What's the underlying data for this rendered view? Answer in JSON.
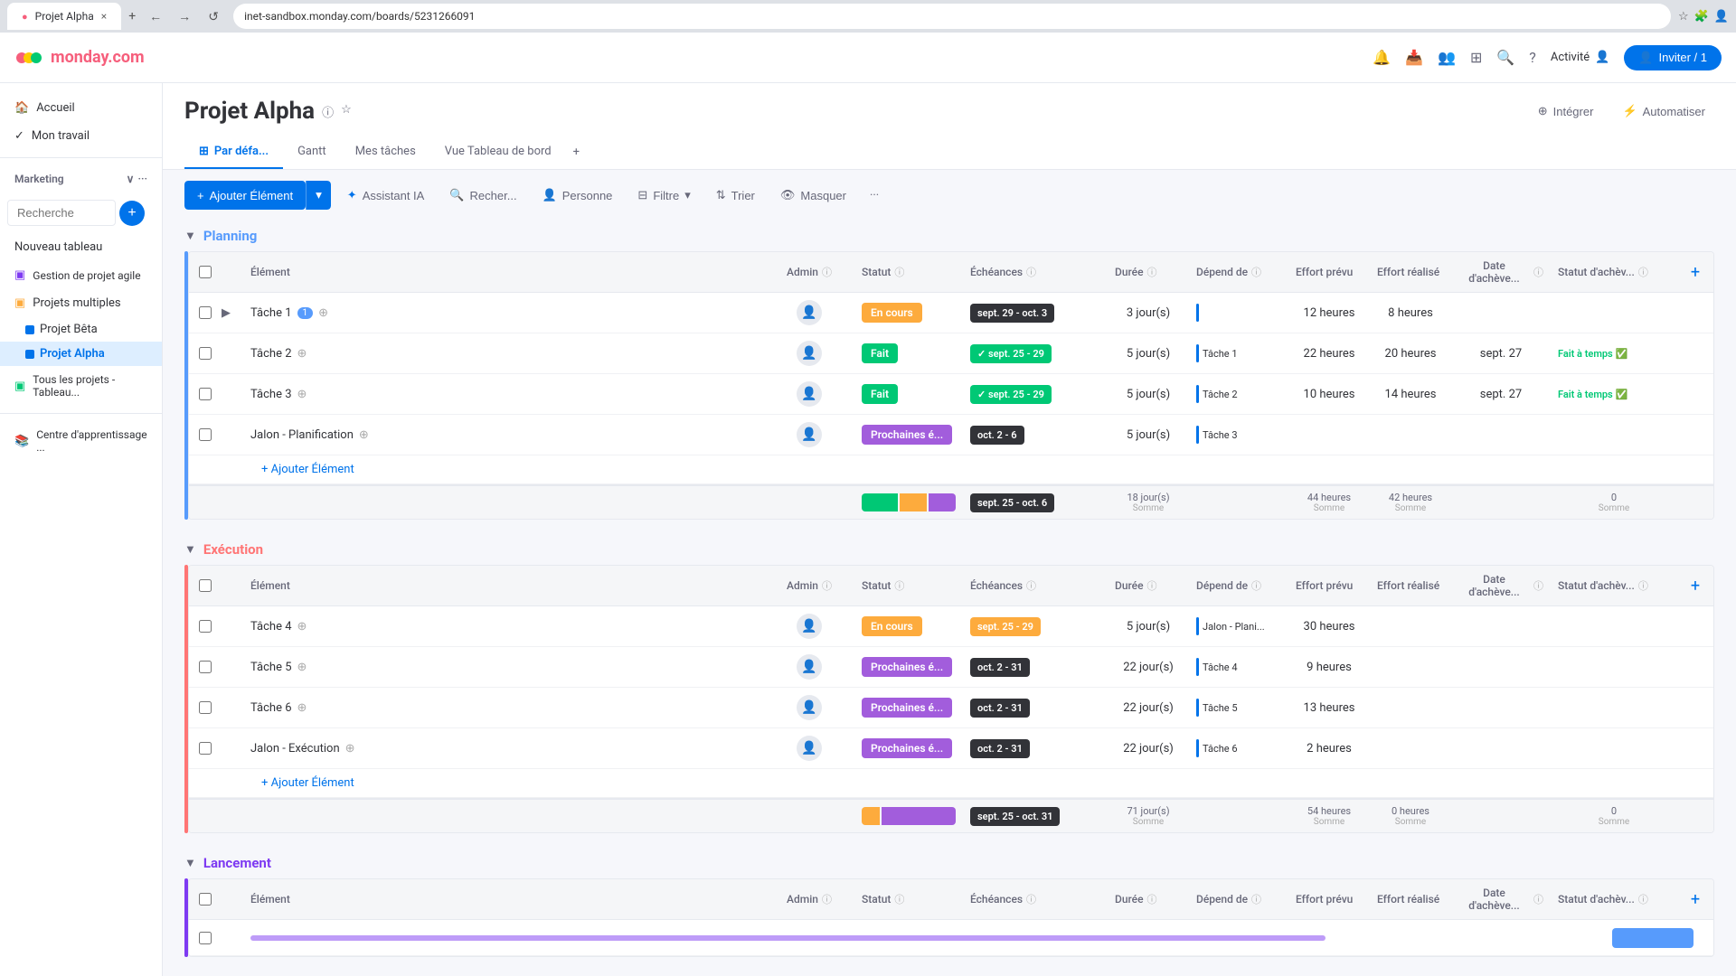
{
  "browser": {
    "tab_title": "Projet Alpha",
    "url": "inet-sandbox.monday.com/boards/5231266091",
    "close_icon": "×",
    "back_icon": "←",
    "forward_icon": "→",
    "refresh_icon": "↺"
  },
  "nav": {
    "logo_text": "monday.com",
    "activity_label": "Activité",
    "inviter_label": "Inviter / 1"
  },
  "sidebar": {
    "accueil": "Accueil",
    "mon_travail": "Mon travail",
    "marketing_label": "Marketing",
    "search_placeholder": "Recherche",
    "nouveau_tableau": "Nouveau tableau",
    "gestion_projet": "Gestion de projet agile",
    "projets_multiples": "Projets multiples",
    "projet_beta": "Projet Bêta",
    "projet_alpha": "Projet Alpha",
    "tous_projets": "Tous les projets - Tableau...",
    "centre_apprentissage": "Centre d'apprentissage ..."
  },
  "page": {
    "title": "Projet Alpha",
    "integrer_label": "Intégrer",
    "automatiser_label": "Automatiser",
    "tabs": [
      {
        "label": "Par défa...",
        "active": true,
        "icon": "⊞"
      },
      {
        "label": "Gantt",
        "active": false
      },
      {
        "label": "Mes tâches",
        "active": false
      },
      {
        "label": "Vue Tableau de bord",
        "active": false
      }
    ]
  },
  "toolbar": {
    "ajouter_element": "Ajouter Élément",
    "assistant_ia": "Assistant IA",
    "rechercher": "Recher...",
    "personne": "Personne",
    "filtre": "Filtre",
    "trier": "Trier",
    "masquer": "Masquer"
  },
  "columns": {
    "element": "Élément",
    "admin": "Admin",
    "statut": "Statut",
    "echeances": "Échéances",
    "duree": "Durée",
    "depend_de": "Dépend de",
    "effort_prevu": "Effort prévu",
    "effort_realise": "Effort réalisé",
    "date_achevement": "Date d'achève...",
    "statut_achevement": "Statut d'achèv..."
  },
  "planning": {
    "title": "Planning",
    "rows": [
      {
        "name": "Tâche 1",
        "badge": "1",
        "statut": "En cours",
        "statut_class": "status-encours",
        "echeance": "sept. 29 - oct. 3",
        "echeance_class": "date-badge",
        "duree": "3 jour(s)",
        "depend": "",
        "effort_prev": "12 heures",
        "effort_real": "8 heures",
        "date_ach": "",
        "statut_ach": "",
        "statut_ach_class": ""
      },
      {
        "name": "Tâche 2",
        "badge": "",
        "statut": "Fait",
        "statut_class": "status-fait",
        "echeance": "✓ sept. 25 - 29",
        "echeance_class": "date-badge green",
        "duree": "5 jour(s)",
        "depend": "Tâche 1",
        "effort_prev": "22 heures",
        "effort_real": "20 heures",
        "date_ach": "sept. 27",
        "statut_ach": "Fait à temps",
        "statut_ach_class": "fait-at"
      },
      {
        "name": "Tâche 3",
        "badge": "",
        "statut": "Fait",
        "statut_class": "status-fait",
        "echeance": "✓ sept. 25 - 29",
        "echeance_class": "date-badge green",
        "duree": "5 jour(s)",
        "depend": "Tâche 2",
        "effort_prev": "10 heures",
        "effort_real": "14 heures",
        "date_ach": "sept. 27",
        "statut_ach": "Fait à temps",
        "statut_ach_class": "fait-at"
      },
      {
        "name": "Jalon - Planification",
        "badge": "",
        "statut": "Prochaines é...",
        "statut_class": "status-prochaines",
        "echeance": "oct. 2 - 6",
        "echeance_class": "date-badge",
        "duree": "5 jour(s)",
        "depend": "Tâche 3",
        "effort_prev": "",
        "effort_real": "",
        "date_ach": "",
        "statut_ach": "",
        "statut_ach_class": ""
      }
    ],
    "summary": {
      "echeance": "sept. 25 - oct. 6",
      "duree": "18 jour(s)",
      "duree_label": "Somme",
      "effort_prev": "44 heures",
      "effort_prev_label": "Somme",
      "effort_real": "42 heures",
      "effort_real_label": "Somme",
      "statut_ach": "0",
      "statut_ach_label": "Somme"
    }
  },
  "execution": {
    "title": "Exécution",
    "rows": [
      {
        "name": "Tâche 4",
        "statut": "En cours",
        "statut_class": "status-encours",
        "echeance": "sept. 25 - 29",
        "echeance_class": "date-badge orange",
        "duree": "5 jour(s)",
        "depend": "Jalon - Plani...",
        "effort_prev": "30 heures",
        "effort_real": "",
        "date_ach": "",
        "statut_ach": "",
        "statut_ach_class": ""
      },
      {
        "name": "Tâche 5",
        "statut": "Prochaines é...",
        "statut_class": "status-prochaines",
        "echeance": "oct. 2 - 31",
        "echeance_class": "date-badge",
        "duree": "22 jour(s)",
        "depend": "Tâche 4",
        "effort_prev": "9 heures",
        "effort_real": "",
        "date_ach": "",
        "statut_ach": "",
        "statut_ach_class": ""
      },
      {
        "name": "Tâche 6",
        "statut": "Prochaines é...",
        "statut_class": "status-prochaines",
        "echeance": "oct. 2 - 31",
        "echeance_class": "date-badge",
        "duree": "22 jour(s)",
        "depend": "Tâche 5",
        "effort_prev": "13 heures",
        "effort_real": "",
        "date_ach": "",
        "statut_ach": "",
        "statut_ach_class": ""
      },
      {
        "name": "Jalon - Exécution",
        "statut": "Prochaines é...",
        "statut_class": "status-prochaines",
        "echeance": "oct. 2 - 31",
        "echeance_class": "date-badge",
        "duree": "22 jour(s)",
        "depend": "Tâche 6",
        "effort_prev": "2 heures",
        "effort_real": "",
        "date_ach": "",
        "statut_ach": "",
        "statut_ach_class": ""
      }
    ],
    "summary": {
      "echeance": "sept. 25 - oct. 31",
      "duree": "71 jour(s)",
      "duree_label": "Somme",
      "effort_prev": "54 heures",
      "effort_prev_label": "Somme",
      "effort_real": "0 heures",
      "effort_real_label": "Somme",
      "statut_ach": "0",
      "statut_ach_label": "Somme"
    }
  },
  "lancement": {
    "title": "Lancement"
  },
  "colors": {
    "planning": "#579bfc",
    "execution": "#ff7575",
    "lancement": "#7e3af2",
    "primary": "#0073ea"
  }
}
